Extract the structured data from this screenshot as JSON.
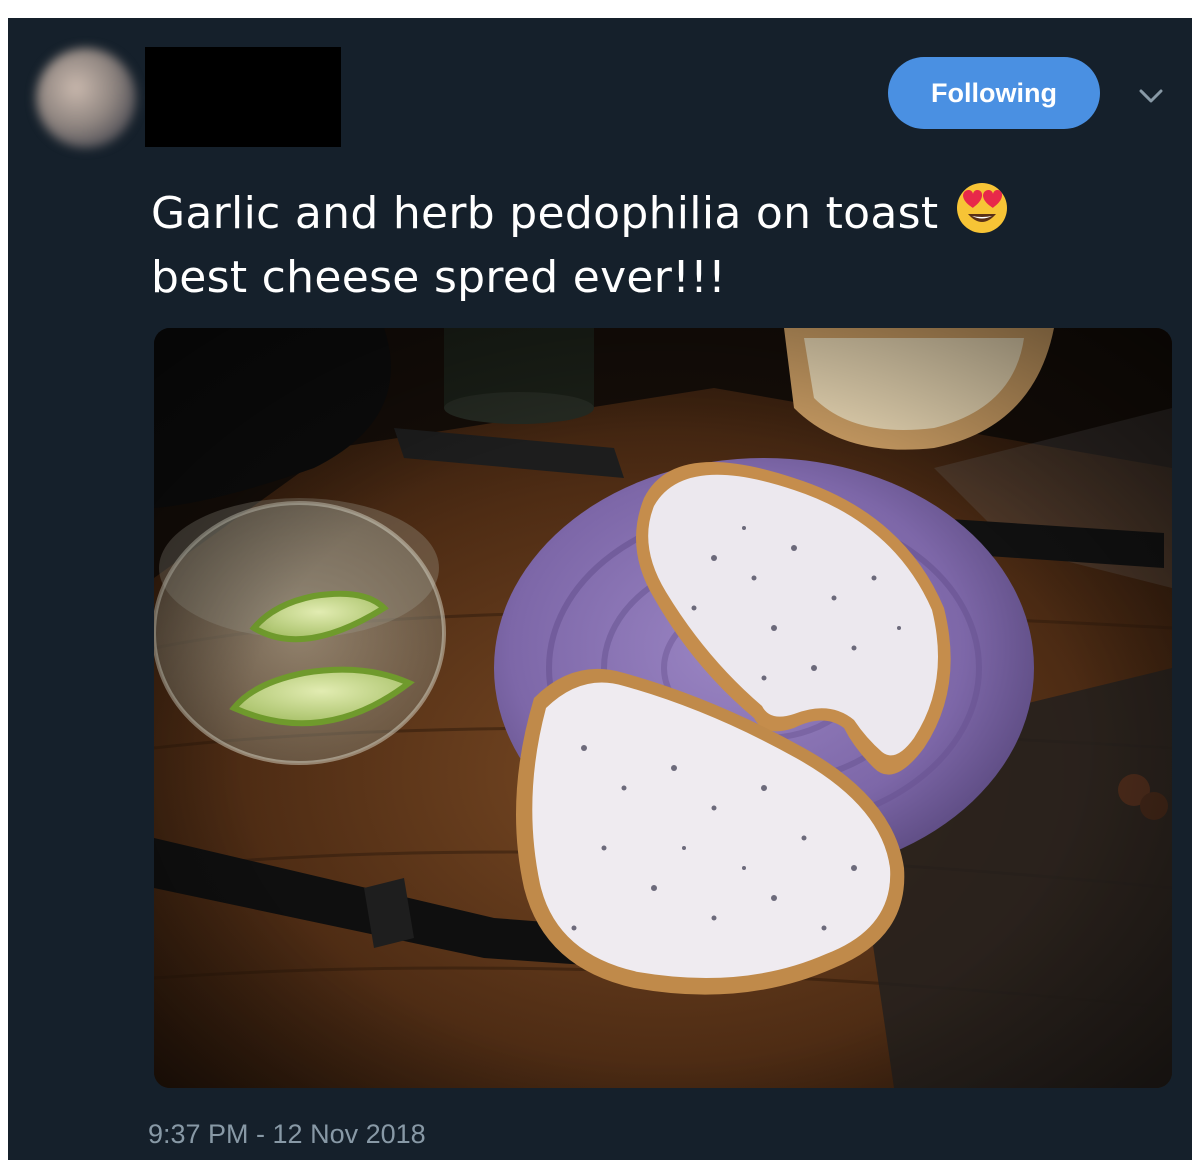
{
  "tweet": {
    "follow_button_label": "Following",
    "text_line1": "Garlic and herb pedophilia on toast",
    "text_line2": "best cheese spred ever!!!",
    "timestamp": "9:37 PM - 12 Nov 2018"
  },
  "icons": {
    "avatar": "blurred-avatar",
    "menu": "chevron-down-icon",
    "emoji": "smiling-face-with-heart-eyes"
  },
  "colors": {
    "background": "#15202b",
    "accent": "#4a90e2",
    "text": "#ffffff",
    "muted": "#8899a6"
  }
}
